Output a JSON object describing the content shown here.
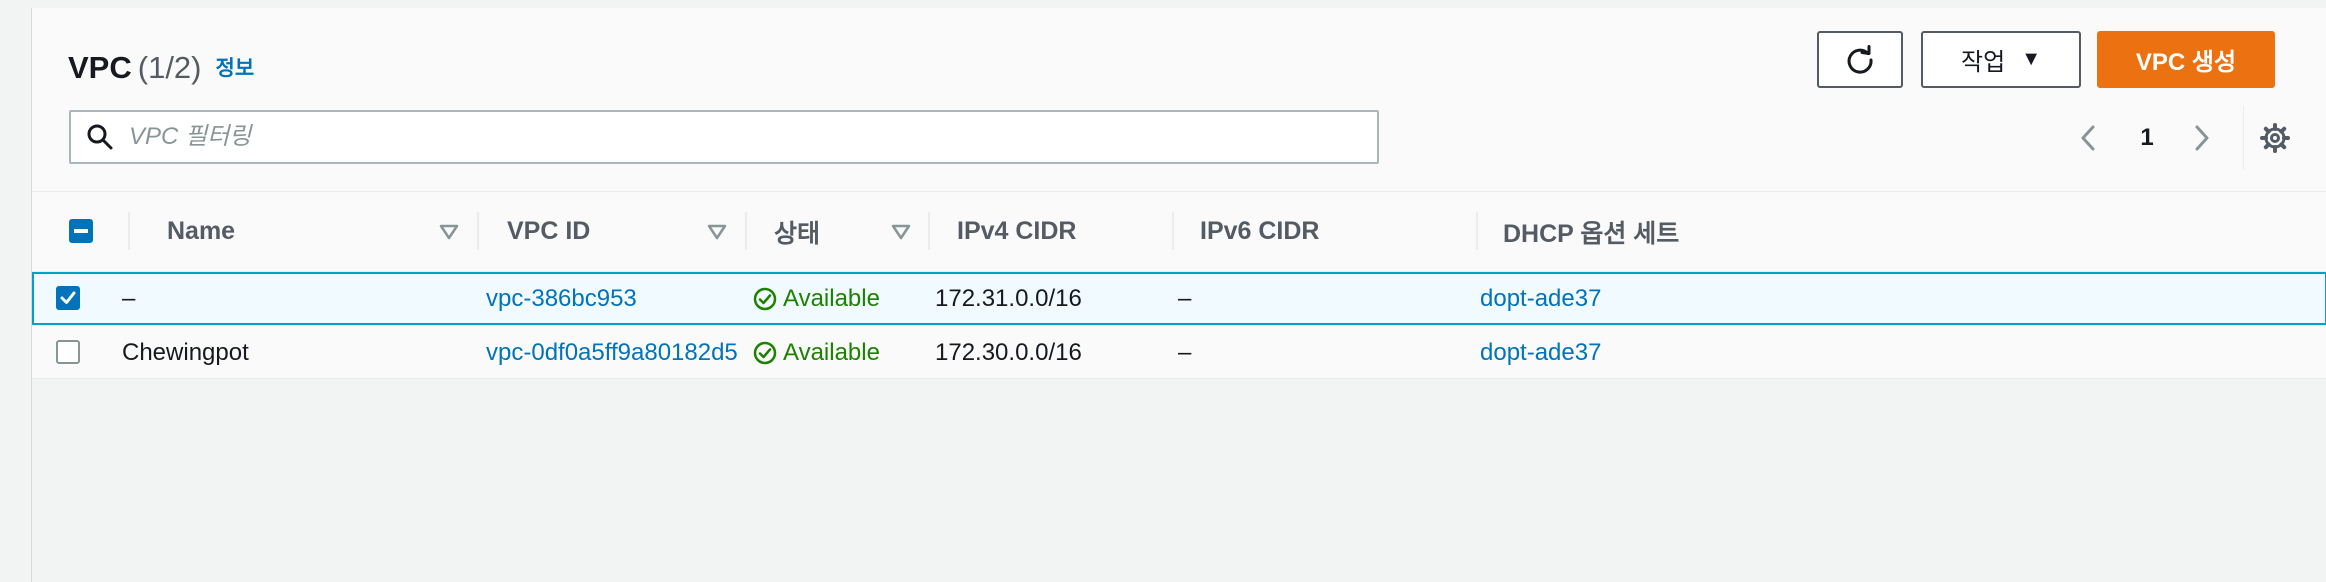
{
  "header": {
    "title": "VPC",
    "count": "(1/2)",
    "info_link": "정보",
    "actions_label": "작업",
    "create_label": "VPC 생성"
  },
  "search": {
    "placeholder": "VPC 필터링",
    "value": ""
  },
  "pagination": {
    "current_page": "1"
  },
  "table": {
    "columns": [
      "Name",
      "VPC ID",
      "상태",
      "IPv4 CIDR",
      "IPv6 CIDR",
      "DHCP 옵션 세트"
    ],
    "rows": [
      {
        "selected": true,
        "name": "–",
        "vpc_id": "vpc-386bc953",
        "state": "Available",
        "ipv4_cidr": "172.31.0.0/16",
        "ipv6_cidr": "–",
        "dhcp_options": "dopt-ade37"
      },
      {
        "selected": false,
        "name": "Chewingpot",
        "vpc_id": "vpc-0df0a5ff9a80182d5",
        "state": "Available",
        "ipv4_cidr": "172.30.0.0/16",
        "ipv6_cidr": "–",
        "dhcp_options": "dopt-ade37"
      }
    ]
  },
  "icons": {
    "refresh": "refresh-icon",
    "caret": "caret-down-icon",
    "search": "search-icon",
    "prev": "chevron-left-icon",
    "next": "chevron-right-icon",
    "settings": "gear-icon",
    "sort": "sort-down-icon",
    "status": "status-available-icon"
  },
  "colors": {
    "primary": "#ec7211",
    "link": "#0073bb",
    "success": "#1d8102",
    "selected_border": "#00a1c9",
    "selected_bg": "#f1faff"
  }
}
